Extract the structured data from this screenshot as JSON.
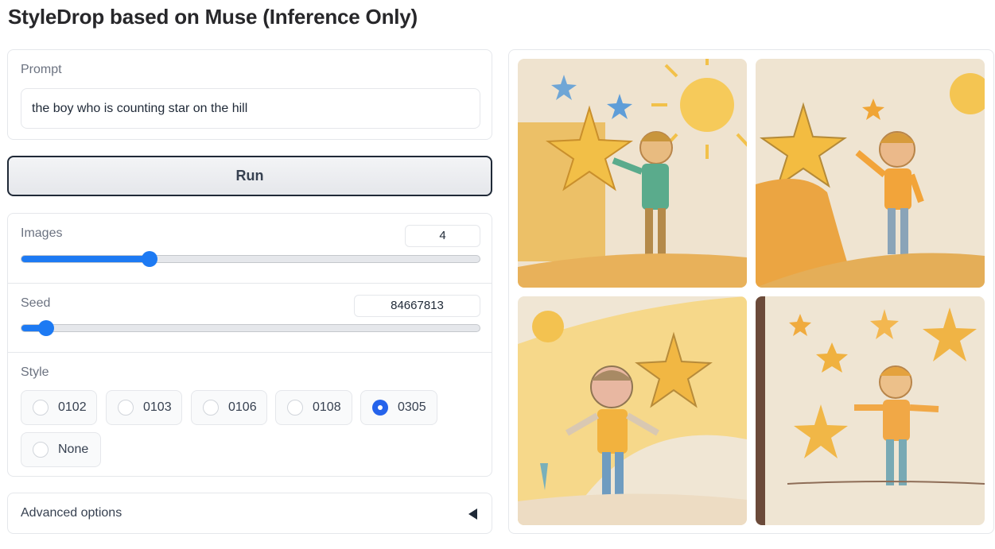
{
  "app": {
    "title": "StyleDrop based on Muse (Inference Only)"
  },
  "prompt": {
    "label": "Prompt",
    "value": "the boy who is counting star on the hill"
  },
  "run": {
    "label": "Run"
  },
  "images": {
    "label": "Images",
    "value": "4",
    "fraction": 0.28
  },
  "seed": {
    "label": "Seed",
    "value": "84667813",
    "fraction": 0.055
  },
  "style": {
    "label": "Style",
    "options": [
      "0102",
      "0103",
      "0106",
      "0108",
      "0305",
      "None"
    ],
    "selected": "0305"
  },
  "advanced": {
    "label": "Advanced options"
  },
  "gallery": {
    "images": [
      {
        "name": "generated-image-1"
      },
      {
        "name": "generated-image-2"
      },
      {
        "name": "generated-image-3"
      },
      {
        "name": "generated-image-4"
      }
    ]
  },
  "colors": {
    "accent": "#1d7af3",
    "radio_selected": "#2563eb"
  }
}
